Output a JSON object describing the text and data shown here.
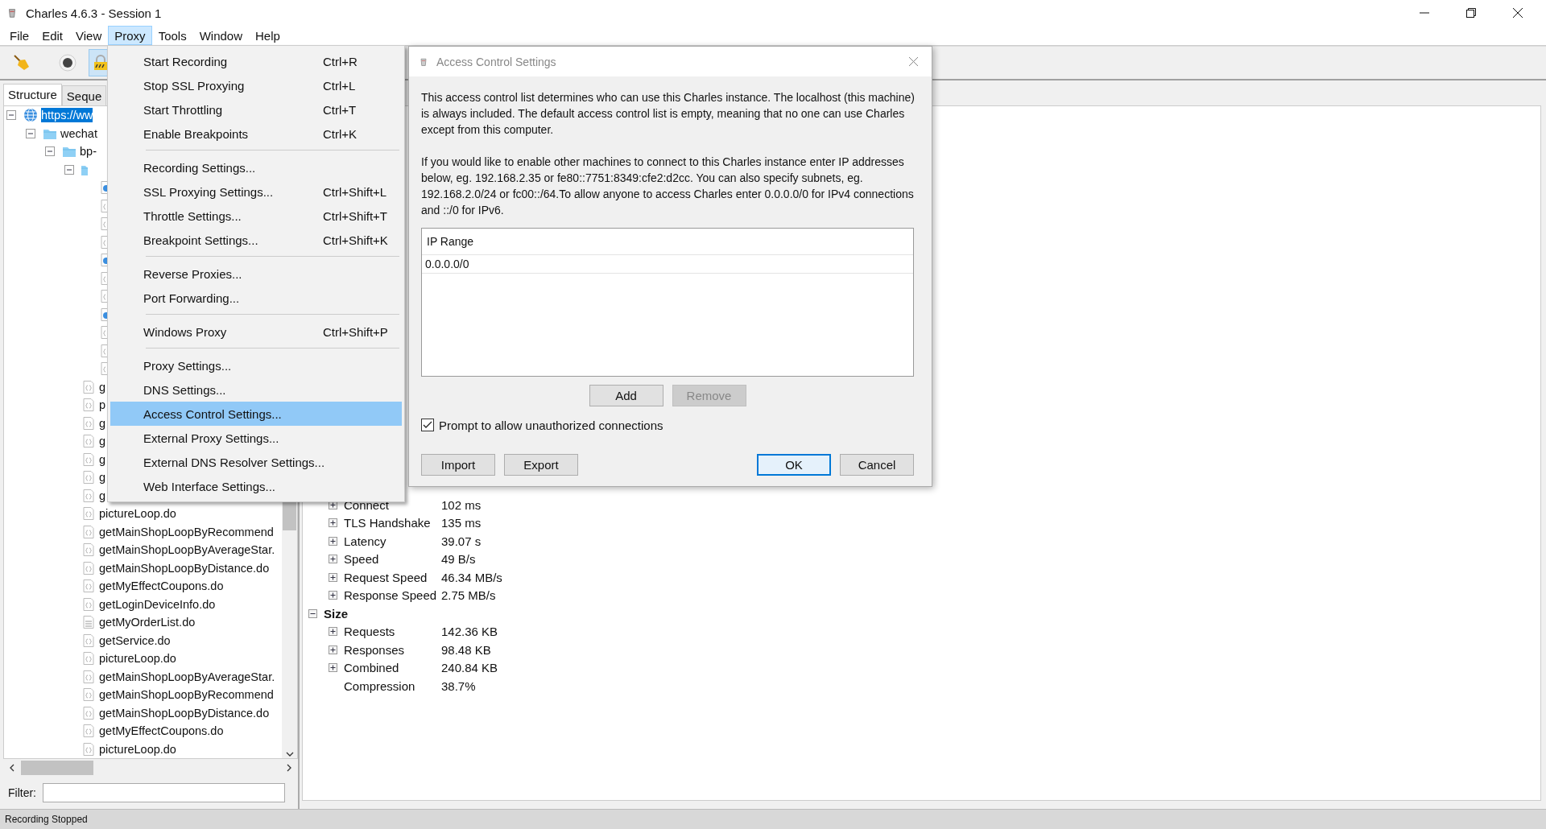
{
  "window": {
    "title": "Charles 4.6.3 - Session 1"
  },
  "menubar": [
    {
      "label": "File",
      "selected": false
    },
    {
      "label": "Edit",
      "selected": false
    },
    {
      "label": "View",
      "selected": false
    },
    {
      "label": "Proxy",
      "selected": true
    },
    {
      "label": "Tools",
      "selected": false
    },
    {
      "label": "Window",
      "selected": false
    },
    {
      "label": "Help",
      "selected": false
    }
  ],
  "toolbar": [
    {
      "kind": "broom",
      "selected": false
    },
    {
      "kind": "record",
      "selected": false
    },
    {
      "kind": "lock",
      "selected": true
    }
  ],
  "left_tabs": [
    {
      "label": "Structure",
      "selected": true
    },
    {
      "label": "Seque",
      "selected": false
    }
  ],
  "tree": {
    "items": [
      {
        "label": "https://ww",
        "kind": "globe",
        "selected": true,
        "expanded": true,
        "children": [
          {
            "label": "wechat",
            "kind": "folder",
            "selected": false,
            "expanded": true,
            "children": [
              {
                "label": "bp-",
                "kind": "folder",
                "selected": false,
                "expanded": true,
                "children": [
                  {
                    "kind": "folder",
                    "selected": false,
                    "expanded": true,
                    "children": [
                      {
                        "kind": "web",
                        "selected": false
                      },
                      {
                        "kind": "json",
                        "selected": false
                      },
                      {
                        "kind": "json",
                        "selected": false
                      },
                      {
                        "kind": "json",
                        "selected": false
                      },
                      {
                        "kind": "web",
                        "selected": false
                      },
                      {
                        "kind": "json",
                        "selected": false
                      },
                      {
                        "kind": "json",
                        "selected": false
                      },
                      {
                        "kind": "web",
                        "selected": false
                      },
                      {
                        "kind": "json",
                        "selected": false
                      },
                      {
                        "kind": "json",
                        "selected": false
                      },
                      {
                        "kind": "json",
                        "selected": false
                      }
                    ]
                  },
                  {
                    "label": "g",
                    "kind": "json",
                    "selected": false
                  },
                  {
                    "label": "p",
                    "kind": "json",
                    "selected": false
                  },
                  {
                    "label": "g",
                    "kind": "json",
                    "selected": false
                  },
                  {
                    "label": "g",
                    "kind": "json",
                    "selected": false
                  },
                  {
                    "label": "g",
                    "kind": "json",
                    "selected": false
                  },
                  {
                    "label": "g",
                    "kind": "json",
                    "selected": false
                  },
                  {
                    "label": "g",
                    "kind": "json",
                    "selected": false
                  },
                  {
                    "label": "pictureLoop.do",
                    "kind": "json",
                    "selected": false
                  },
                  {
                    "label": "getMainShopLoopByRecommend",
                    "kind": "json",
                    "selected": false
                  },
                  {
                    "label": "getMainShopLoopByAverageStar.",
                    "kind": "json",
                    "selected": false
                  },
                  {
                    "label": "getMainShopLoopByDistance.do",
                    "kind": "json",
                    "selected": false
                  },
                  {
                    "label": "getMyEffectCoupons.do",
                    "kind": "json",
                    "selected": false
                  },
                  {
                    "label": "getLoginDeviceInfo.do",
                    "kind": "json",
                    "selected": false
                  },
                  {
                    "label": "getMyOrderList.do",
                    "kind": "doc",
                    "selected": false
                  },
                  {
                    "label": "getService.do",
                    "kind": "json",
                    "selected": false
                  },
                  {
                    "label": "pictureLoop.do",
                    "kind": "json",
                    "selected": false
                  },
                  {
                    "label": "getMainShopLoopByAverageStar.",
                    "kind": "json",
                    "selected": false
                  },
                  {
                    "label": "getMainShopLoopByRecommend",
                    "kind": "json",
                    "selected": false
                  },
                  {
                    "label": "getMainShopLoopByDistance.do",
                    "kind": "json",
                    "selected": false
                  },
                  {
                    "label": "getMyEffectCoupons.do",
                    "kind": "json",
                    "selected": false
                  },
                  {
                    "label": "pictureLoop.do",
                    "kind": "json",
                    "selected": false
                  }
                ]
              }
            ]
          }
        ]
      }
    ]
  },
  "filter": {
    "label": "Filter:"
  },
  "stats": {
    "rows": [
      {
        "label": "Connect",
        "value": "102 ms",
        "kind": "expandable",
        "expanded": false
      },
      {
        "label": "TLS Handshake",
        "value": "135 ms",
        "kind": "expandable",
        "expanded": false
      },
      {
        "label": "Latency",
        "value": "39.07 s",
        "kind": "expandable",
        "expanded": false
      },
      {
        "label": "Speed",
        "value": "49 B/s",
        "kind": "expandable",
        "expanded": false
      },
      {
        "label": "Request Speed",
        "value": "46.34 MB/s",
        "kind": "expandable",
        "expanded": false
      },
      {
        "label": "Response Speed",
        "value": "2.75 MB/s",
        "kind": "expandable",
        "expanded": false
      }
    ],
    "size": {
      "label": "Size",
      "expanded": true,
      "rows": [
        {
          "label": "Requests",
          "value": "142.36 KB",
          "kind": "expandable",
          "expanded": false
        },
        {
          "label": "Responses",
          "value": "98.48 KB",
          "kind": "expandable",
          "expanded": false
        },
        {
          "label": "Combined",
          "value": "240.84 KB",
          "kind": "expandable",
          "expanded": false
        },
        {
          "label": "Compression",
          "value": "38.7%",
          "kind": "plain"
        }
      ]
    }
  },
  "status_bar": "Recording Stopped",
  "menu": [
    {
      "kind": "item",
      "label": "Start Recording",
      "shortcut": "Ctrl+R",
      "selected": false
    },
    {
      "kind": "item",
      "label": "Stop SSL Proxying",
      "shortcut": "Ctrl+L",
      "selected": false
    },
    {
      "kind": "item",
      "label": "Start Throttling",
      "shortcut": "Ctrl+T",
      "selected": false
    },
    {
      "kind": "item",
      "label": "Enable Breakpoints",
      "shortcut": "Ctrl+K",
      "selected": false
    },
    {
      "kind": "separator"
    },
    {
      "kind": "item",
      "label": "Recording Settings...",
      "selected": false
    },
    {
      "kind": "item",
      "label": "SSL Proxying Settings...",
      "shortcut": "Ctrl+Shift+L",
      "selected": false
    },
    {
      "kind": "item",
      "label": "Throttle Settings...",
      "shortcut": "Ctrl+Shift+T",
      "selected": false
    },
    {
      "kind": "item",
      "label": "Breakpoint Settings...",
      "shortcut": "Ctrl+Shift+K",
      "selected": false
    },
    {
      "kind": "separator"
    },
    {
      "kind": "item",
      "label": "Reverse Proxies...",
      "selected": false
    },
    {
      "kind": "item",
      "label": "Port Forwarding...",
      "selected": false
    },
    {
      "kind": "separator"
    },
    {
      "kind": "item",
      "label": "Windows Proxy",
      "shortcut": "Ctrl+Shift+P",
      "selected": false
    },
    {
      "kind": "separator"
    },
    {
      "kind": "item",
      "label": "Proxy Settings...",
      "selected": false
    },
    {
      "kind": "item",
      "label": "DNS Settings...",
      "selected": false
    },
    {
      "kind": "item",
      "label": "Access Control Settings...",
      "selected": true
    },
    {
      "kind": "item",
      "label": "External Proxy Settings...",
      "selected": false
    },
    {
      "kind": "item",
      "label": "External DNS Resolver Settings...",
      "selected": false
    },
    {
      "kind": "item",
      "label": "Web Interface Settings...",
      "selected": false
    }
  ],
  "dialog": {
    "title": "Access Control Settings",
    "paragraphs": [
      "This access control list determines who can use this Charles instance. The localhost (this machine) is always included. The default access control list is empty, meaning that no one can use Charles except from this computer.",
      "If you would like to enable other machines to connect to this Charles instance enter IP addresses below, eg. 192.168.2.35 or fe80::7751:8349:cfe2:d2cc. You can also specify subnets, eg. 192.168.2.0/24 or fc00::/64.To allow anyone to access Charles enter 0.0.0.0/0 for IPv4 connections and ::/0 for IPv6."
    ],
    "table": {
      "column": "IP Range",
      "rows": [
        "0.0.0.0/0"
      ]
    },
    "list_buttons": [
      {
        "label": "Add",
        "disabled": false
      },
      {
        "label": "Remove",
        "disabled": true
      }
    ],
    "checkbox": {
      "label": "Prompt to allow unauthorized connections",
      "checked": true
    },
    "footer_left": [
      {
        "label": "Import",
        "default": false
      },
      {
        "label": "Export",
        "default": false
      }
    ],
    "footer_right": [
      {
        "label": "OK",
        "default": true
      },
      {
        "label": "Cancel",
        "default": false
      }
    ]
  }
}
